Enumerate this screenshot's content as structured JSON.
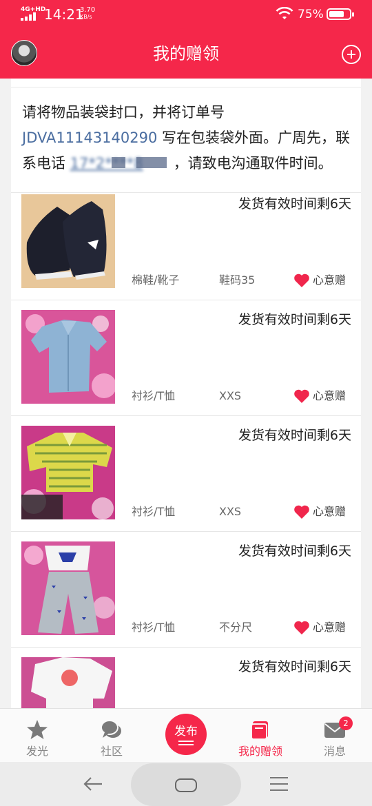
{
  "status_bar": {
    "network": "4G+HD",
    "time": "14:21",
    "speed_value": "3.70",
    "speed_unit": "KB/s",
    "battery_percent": "75%",
    "battery_level": 0.75
  },
  "header": {
    "title": "我的赠领",
    "avatar_icon": "user-avatar",
    "add_icon": "plus-circle-icon",
    "background": "#f5274a"
  },
  "notice": {
    "text_before": "请将物品装袋封口，并将订单号 ",
    "order_number": "JDVA11143140290",
    "text_middle": " 写在包装袋外面。广周先，联系电话 ",
    "phone_masked": "17*2****8",
    "text_after": "，请致电沟通取件时间。"
  },
  "items": [
    {
      "deadline": "发货有效时间剩6天",
      "category": "棉鞋/靴子",
      "size": "鞋码35",
      "tag": "心意赠",
      "thumb": "black-sneakers"
    },
    {
      "deadline": "发货有效时间剩6天",
      "category": "衬衫/T恤",
      "size": "XXS",
      "tag": "心意赠",
      "thumb": "denim-shirt"
    },
    {
      "deadline": "发货有效时间剩6天",
      "category": "衬衫/T恤",
      "size": "XXS",
      "tag": "心意赠",
      "thumb": "striped-yellow-shirt"
    },
    {
      "deadline": "发货有效时间剩6天",
      "category": "衬衫/T恤",
      "size": "不分尺",
      "tag": "心意赠",
      "thumb": "superman-pajama-set"
    },
    {
      "deadline": "发货有效时间剩6天",
      "category": "",
      "size": "",
      "tag": "",
      "thumb": "cartoon-tee-with-pants"
    }
  ],
  "tabbar": {
    "tabs": [
      {
        "label": "发光",
        "icon": "star-icon"
      },
      {
        "label": "社区",
        "icon": "chat-bubbles-icon"
      },
      {
        "label": "我的赠领",
        "icon": "gift-book-icon",
        "active": true
      },
      {
        "label": "消息",
        "icon": "mail-icon",
        "badge": "2"
      }
    ],
    "publish_label": "发布"
  },
  "nav_bar": {
    "back_icon": "back-arrow-icon",
    "home_icon": "home-pill-icon",
    "menu_icon": "menu-icon"
  },
  "colors": {
    "accent": "#f5274a",
    "link": "#4a6da0",
    "heart": "#f0264c"
  }
}
